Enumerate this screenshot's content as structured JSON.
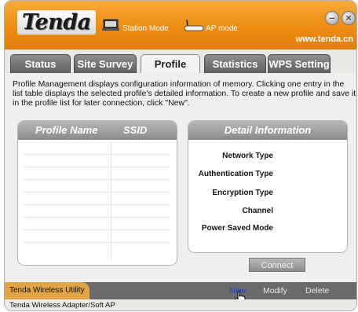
{
  "header": {
    "logo": "Tenda",
    "station_mode_label": "Station Mode",
    "ap_mode_label": "AP mode",
    "website": "www.tenda.cn",
    "minimize_symbol": "–",
    "close_symbol": "×"
  },
  "tabs": [
    "Status",
    "Site Survey",
    "Profile",
    "Statistics",
    "WPS Setting"
  ],
  "active_tab": "Profile",
  "description": "Profile Management displays configuration information of memory. Clicking one entry in the list table displays the selected profile's detailed information. To create a new profile and save it in the profile list for later connection, click \"New\".",
  "profile_table": {
    "col_name": "Profile Name",
    "col_ssid": "SSID"
  },
  "detail": {
    "title": "Detail Information",
    "fields": [
      "Network Type",
      "Authentication Type",
      "Encryption Type",
      "Channel",
      "Power Saved Mode"
    ]
  },
  "connect_label": "Connect",
  "bottom": {
    "utility_label": "Tenda Wireless Utility",
    "new_label": "New",
    "modify_label": "Modify",
    "delete_label": "Delete"
  },
  "status_bar": "Tenda Wireless Adapter/Soft AP",
  "colors": {
    "brand_orange": "#ee8d12",
    "tab_gray": "#6e6e6e",
    "link_blue": "#1a3fd0"
  },
  "icons": [
    "station-mode-icon",
    "ap-mode-icon",
    "minimize-icon",
    "close-icon",
    "hand-cursor-icon"
  ]
}
